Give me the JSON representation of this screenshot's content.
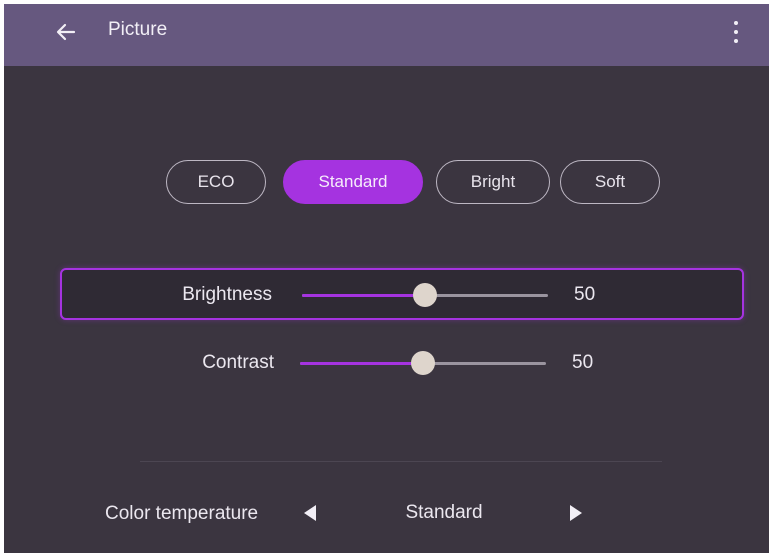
{
  "header": {
    "back_icon": "arrow-left-icon",
    "title": "Picture",
    "menu_icon": "more-vertical-icon"
  },
  "modes": {
    "items": [
      {
        "label": "ECO",
        "active": false
      },
      {
        "label": "Standard",
        "active": true
      },
      {
        "label": "Bright",
        "active": false
      },
      {
        "label": "Soft",
        "active": false
      }
    ]
  },
  "sliders": {
    "brightness": {
      "label": "Brightness",
      "value": "50",
      "level": 0.5,
      "focused": true
    },
    "contrast": {
      "label": "Contrast",
      "value": "50",
      "level": 0.5,
      "focused": false
    }
  },
  "color_temperature": {
    "label": "Color temperature",
    "value": "Standard",
    "prev_icon": "triangle-left-icon",
    "next_icon": "triangle-right-icon"
  },
  "colors": {
    "header_bg": "#66587f",
    "panel_bg": "#3b3540",
    "accent": "#a533e0",
    "thumb": "#ded5cc"
  }
}
